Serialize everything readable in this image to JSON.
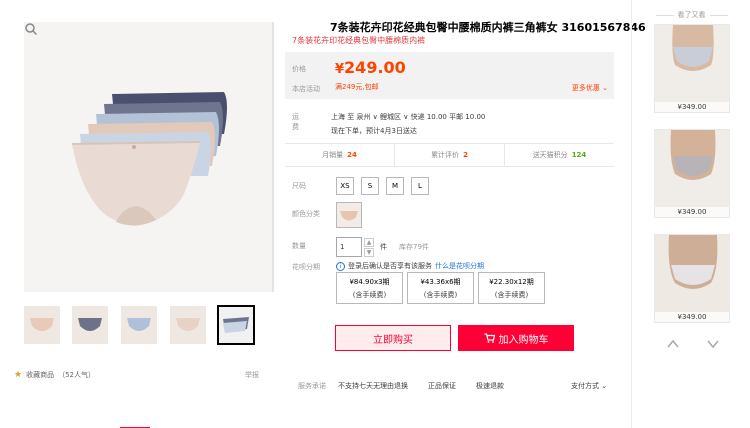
{
  "product": {
    "title": "7条装花卉印花经典包臀中腰棉质内裤三角裤女 31601567846",
    "subtitle": "7条装花卉印花经典包臀中腰棉质内裤"
  },
  "price_section": {
    "price_label": "价格",
    "price_currency": "¥",
    "price_value": "249.00",
    "promo_label": "本店活动",
    "promo_text": "满249元,包邮",
    "more_link": "更多优惠"
  },
  "shipping": {
    "label": "运费",
    "route": "上海 至 泉州 ∨ 鲤城区 ∨ 快递 10.00 平邮 10.00",
    "eta": "现在下单，预计4月3日送达"
  },
  "stats": [
    {
      "label": "月销量",
      "value": "24"
    },
    {
      "label": "累计评价",
      "value": "2"
    },
    {
      "label": "送天猫积分",
      "value": "124"
    }
  ],
  "options": {
    "size_label": "尺码",
    "sizes": [
      "XS",
      "S",
      "M",
      "L"
    ],
    "color_label": "颜色分类",
    "qty_label": "数量",
    "qty_value": "1",
    "qty_unit": "件",
    "stock": "库存79件",
    "huabei_label": "花呗分期",
    "huabei_note": "登录后确认是否享有该服务",
    "huabei_link": "什么是花呗分期",
    "plans": [
      {
        "amount": "¥84.90x3期",
        "fee": "(含手续费)"
      },
      {
        "amount": "¥43.36x6期",
        "fee": "(含手续费)"
      },
      {
        "amount": "¥22.30x12期",
        "fee": "(含手续费)"
      }
    ]
  },
  "actions": {
    "buy_now": "立即购买",
    "add_cart": "加入购物车"
  },
  "service": {
    "label": "服务承诺",
    "items": [
      "不支持七天无理由退换",
      "正品保证",
      "极速退款"
    ],
    "payment": "支付方式"
  },
  "gallery": {
    "favorite": "收藏商品",
    "favorite_count": "（52人气）",
    "report": "举报"
  },
  "sidebar": {
    "title": "看了又看",
    "items": [
      {
        "price": "¥349.00"
      },
      {
        "price": "¥349.00"
      },
      {
        "price": "¥349.00"
      }
    ]
  },
  "colors": {
    "accent": "#ff0036",
    "price": "#ff4400"
  }
}
